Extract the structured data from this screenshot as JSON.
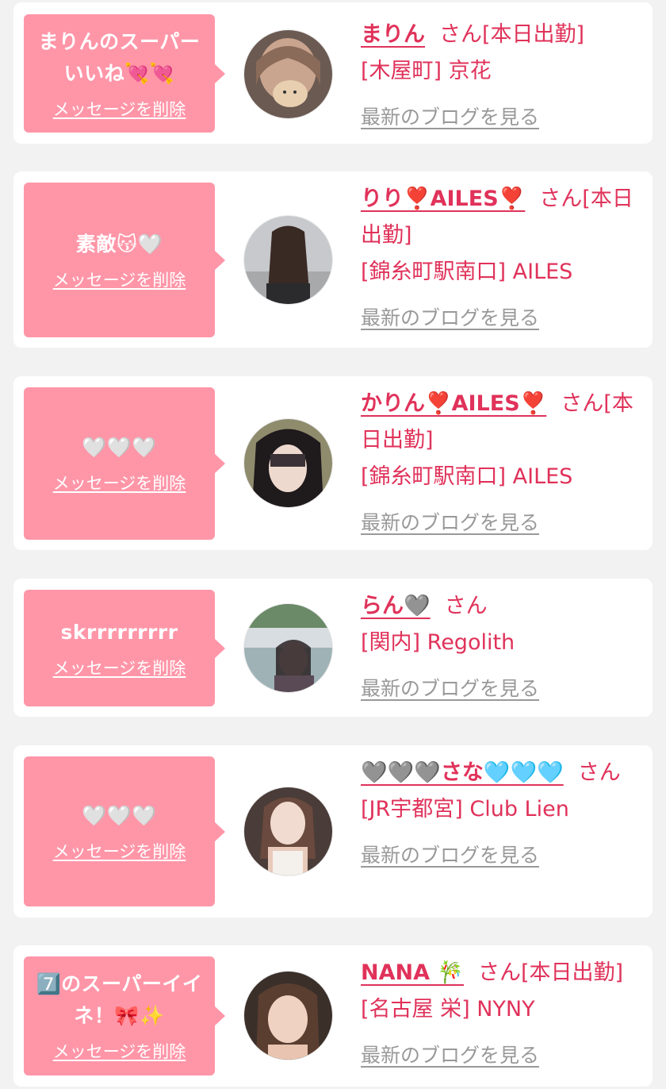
{
  "cards": [
    {
      "message": "まりんのスーパー\nいいね💘💘",
      "delete_label": "メッセージを削除",
      "name": "まりん",
      "honorific": "さん",
      "status": "[本日出勤]",
      "location": "[木屋町] 京花",
      "blog_label": "最新のブログを見る"
    },
    {
      "message": "素敵😽🤍",
      "delete_label": "メッセージを削除",
      "name": "りり❣️AILES❣️",
      "honorific": "さん",
      "status": "[本日出勤]",
      "location": "[錦糸町駅南口] AILES",
      "blog_label": "最新のブログを見る"
    },
    {
      "message": "🤍🤍🤍",
      "delete_label": "メッセージを削除",
      "name": "かりん❣️AILES❣️",
      "honorific": "さん",
      "status": "[本日出勤]",
      "location": "[錦糸町駅南口] AILES",
      "blog_label": "最新のブログを見る"
    },
    {
      "message": "skrrrrrrrrr",
      "delete_label": "メッセージを削除",
      "name": "らん🩶",
      "honorific": "さん",
      "status": "",
      "location": "[関内] Regolith",
      "blog_label": "最新のブログを見る"
    },
    {
      "message": "🤍🤍🤍",
      "delete_label": "メッセージを削除",
      "name": "🩶🩶🩶さな🩵🩵🩵",
      "honorific": "さん",
      "status": "",
      "location": "[JR宇都宮] Club Lien",
      "blog_label": "最新のブログを見る"
    },
    {
      "message": "7️⃣のスーパーイイ\nネ！🎀✨",
      "delete_label": "メッセージを削除",
      "name": "NANA 🎋",
      "honorific": "さん",
      "status": "[本日出勤]",
      "location": "[名古屋 栄] NYNY",
      "blog_label": "最新のブログを見る"
    }
  ],
  "colors": {
    "page_bg": "#f2f2f2",
    "bubble": "#ff96a8",
    "accent": "#e0325a",
    "muted": "#999999"
  }
}
